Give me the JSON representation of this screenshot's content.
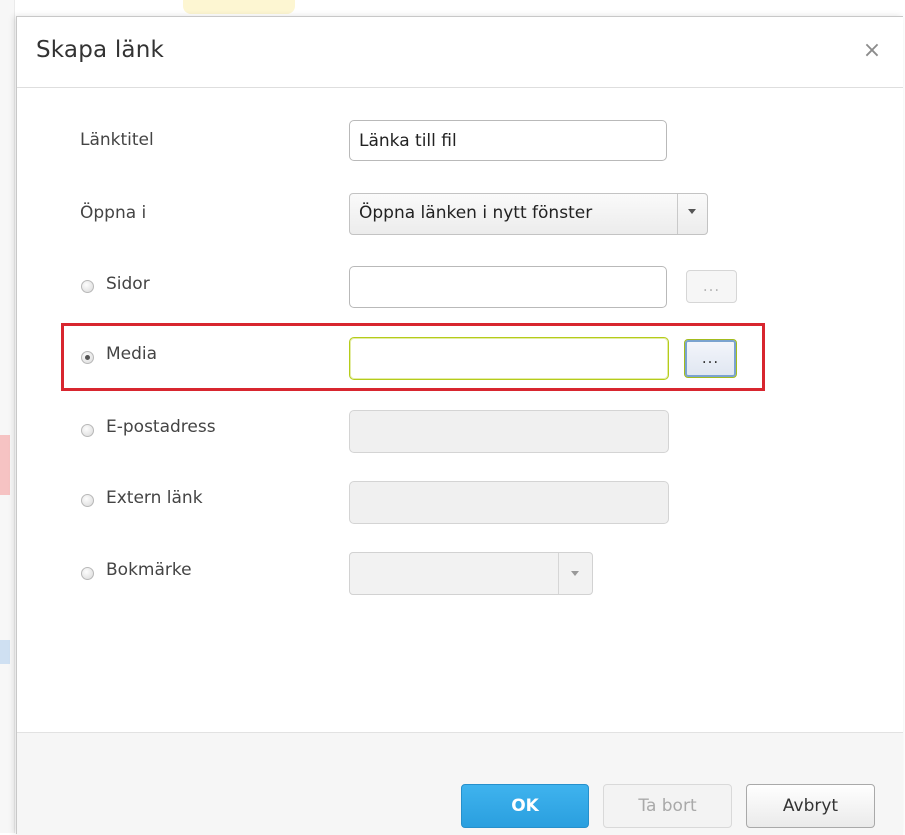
{
  "dialog": {
    "title": "Skapa länk",
    "close_label": "×"
  },
  "form": {
    "link_title": {
      "label": "Länktitel",
      "value": "Länka till fil"
    },
    "open_in": {
      "label": "Öppna i",
      "selected": "Öppna länken i nytt fönster"
    },
    "pages": {
      "label": "Sidor",
      "value": "",
      "browse_label": "...",
      "checked": false
    },
    "media": {
      "label": "Media",
      "value": "",
      "browse_label": "...",
      "checked": true
    },
    "email": {
      "label": "E-postadress",
      "value": "",
      "checked": false
    },
    "external": {
      "label": "Extern länk",
      "value": "",
      "checked": false
    },
    "bookmark": {
      "label": "Bokmärke",
      "selected": "",
      "checked": false
    }
  },
  "footer": {
    "ok_label": "OK",
    "remove_label": "Ta bort",
    "cancel_label": "Avbryt"
  },
  "colors": {
    "ok_button": "#2a9fdf",
    "highlight": "#d8262f",
    "focus_border": "#b5cc1a"
  }
}
